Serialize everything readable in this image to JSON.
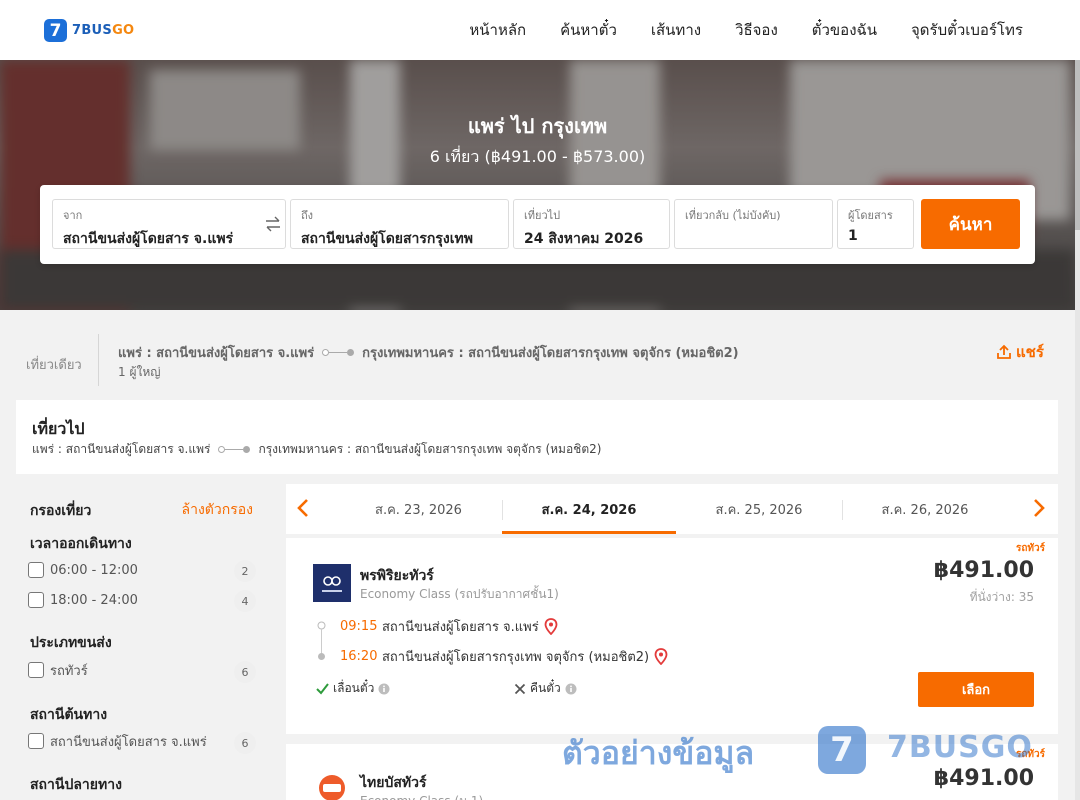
{
  "header": {
    "logo_mark": "7",
    "logo_part1": "7BUS",
    "logo_part2": "GO",
    "nav": [
      "หน้าหลัก",
      "ค้นหาตั๋ว",
      "เส้นทาง",
      "วิธีจอง",
      "ตั๋วของฉัน",
      "จุดรับตั๋วเบอร์โทร"
    ]
  },
  "hero": {
    "title": "แพร่ ไป กรุงเทพ",
    "subtitle": "6 เที่ยว (฿491.00 - ฿573.00)"
  },
  "search": {
    "from_label": "จาก",
    "from_value": "สถานีขนส่งผู้โดยสาร จ.แพร่",
    "to_label": "ถึง",
    "to_value": "สถานีขนส่งผู้โดยสารกรุงเทพ",
    "depart_label": "เที่ยวไป",
    "depart_value": "24 สิงหาคม 2026",
    "return_label": "เที่ยวกลับ (ไม่บังคับ)",
    "return_value": "",
    "pax_label": "ผู้โดยสาร",
    "pax_value": "1",
    "button": "ค้นหา"
  },
  "trip": {
    "type": "เที่ยวเดียว",
    "from": "แพร่ : สถานีขนส่งผู้โดยสาร จ.แพร่",
    "to": "กรุงเทพมหานคร : สถานีขนส่งผู้โดยสารกรุงเทพ จตุจักร (หมอชิต2)",
    "passengers": "1 ผู้ใหญ่",
    "share": "แชร์"
  },
  "outbound": {
    "title": "เที่ยวไป",
    "from": "แพร่ : สถานีขนส่งผู้โดยสาร จ.แพร่",
    "to": "กรุงเทพมหานคร : สถานีขนส่งผู้โดยสารกรุงเทพ จตุจักร (หมอชิต2)"
  },
  "filters": {
    "title": "กรองเที่ยว",
    "clear": "ล้างตัวกรอง",
    "groups": [
      {
        "title": "เวลาออกเดินทาง",
        "options": [
          {
            "label": "06:00 - 12:00",
            "count": "2"
          },
          {
            "label": "18:00 - 24:00",
            "count": "4"
          }
        ]
      },
      {
        "title": "ประเภทขนส่ง",
        "options": [
          {
            "label": "รถทัวร์",
            "count": "6"
          }
        ]
      },
      {
        "title": "สถานีต้นทาง",
        "options": [
          {
            "label": "สถานีขนส่งผู้โดยสาร จ.แพร่",
            "count": "6"
          }
        ]
      },
      {
        "title": "สถานีปลายทาง",
        "options": []
      }
    ]
  },
  "dates": {
    "tabs": [
      "ส.ค. 23, 2026",
      "ส.ค. 24, 2026",
      "ส.ค. 25, 2026",
      "ส.ค. 26, 2026"
    ],
    "active_index": 1
  },
  "results": [
    {
      "badge": "รถทัวร์",
      "operator": "พรพิริยะทัวร์",
      "class": "Economy Class (รถปรับอากาศชั้น1)",
      "price": "฿491.00",
      "seats": "ที่นั่งว่าง: 35",
      "depart_time": "09:15",
      "depart_station": "สถานีขนส่งผู้โดยสาร จ.แพร่",
      "arrive_time": "16:20",
      "arrive_station": "สถานีขนส่งผู้โดยสารกรุงเทพ จตุจักร (หมอชิต2)",
      "feature_reschedule": "เลื่อนตั๋ว",
      "feature_refund": "คืนตั๋ว",
      "select": "เลือก"
    },
    {
      "badge": "รถทัวร์",
      "operator": "ไทยบัสทัวร์",
      "class": "Economy Class (ม.1)",
      "price": "฿491.00"
    }
  ],
  "watermark": {
    "text": "ตัวอย่างข้อมูล",
    "logo_mark": "7",
    "brand": "7BUSGO"
  },
  "colors": {
    "accent": "#f76b00",
    "brand_blue": "#1c6fd8"
  }
}
